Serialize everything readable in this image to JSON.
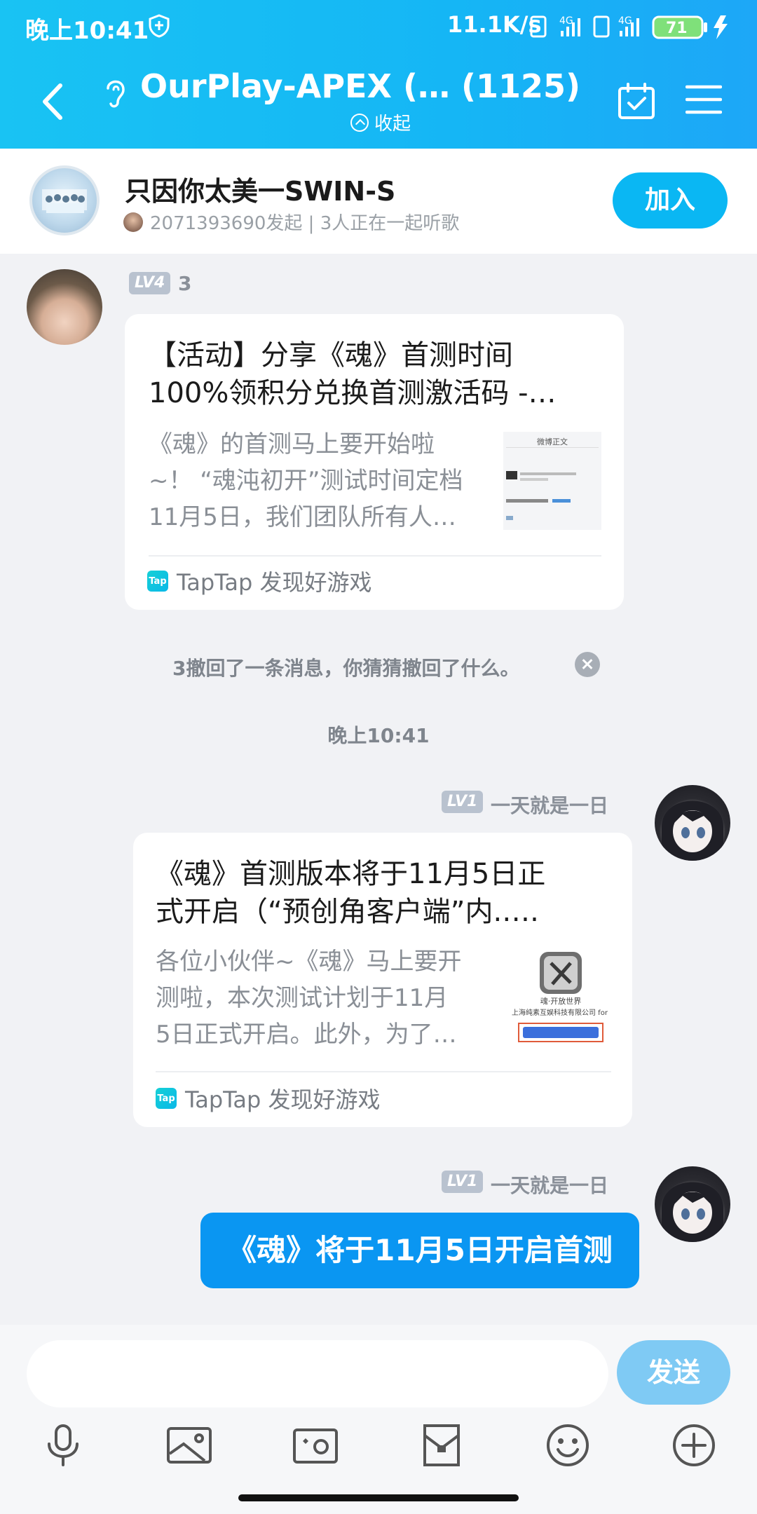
{
  "status_bar": {
    "time": "晚上10:41",
    "net_speed": "11.1K/s",
    "battery": "71",
    "net_label_1": "4G",
    "net_label_2": "4G"
  },
  "header": {
    "title": "OurPlay-APEX (… (1125)",
    "collapse_label": "收起"
  },
  "room": {
    "name": "只因你太美一SWIN-S",
    "subtitle": "2071393690发起 | 3人正在一起听歌",
    "join_label": "加入"
  },
  "messages": [
    {
      "level": "LV4",
      "sender": "3",
      "card": {
        "title_line1": "【活动】分享《魂》首测时间",
        "title_line2": "100%领积分兑换首测激活码 -…",
        "desc_line1": "《魂》的首测马上要开始啦",
        "desc_line2": "~！ “魂沌初开”测试时间定档",
        "desc_line3": "11月5日，我们团队所有人…",
        "source": "TapTap 发现好游戏",
        "thumb_text": "微博正文"
      }
    },
    {
      "level": "LV1",
      "sender": "一天就是一日",
      "card": {
        "title_line1": "《魂》首测版本将于11月5日正",
        "title_line2": "式开启（“预创角客户端”内.….",
        "desc_line1": "各位小伙伴~《魂》马上要开",
        "desc_line2": "测啦，本次测试计划于11月",
        "desc_line3": "5日正式开启。此外，为了…",
        "source": "TapTap 发现好游戏",
        "thumb_text": "魂·开放世界",
        "thumb_subtext": "上海纯素互娱科技有限公司 for i"
      }
    },
    {
      "level": "LV1",
      "sender": "一天就是一日",
      "text": "《魂》将于11月5日开启首测"
    }
  ],
  "system": {
    "recall_notice": "3撤回了一条消息，你猜猜撤回了什么。",
    "timestamp": "晚上10:41"
  },
  "composer": {
    "send_label": "发送",
    "input_value": ""
  },
  "tap_icon_text": "Tap",
  "colors": {
    "header_accent": "#19c3f3",
    "join_button": "#0ab7f3",
    "send_button": "#7fcaf4",
    "message_bubble": "#0a96f2"
  },
  "icons": [
    "shield-icon",
    "back-icon",
    "ear-icon",
    "calendar-icon",
    "menu-icon",
    "mic-icon",
    "image-icon",
    "camera-icon",
    "gift-icon",
    "emoji-icon",
    "plus-icon"
  ]
}
